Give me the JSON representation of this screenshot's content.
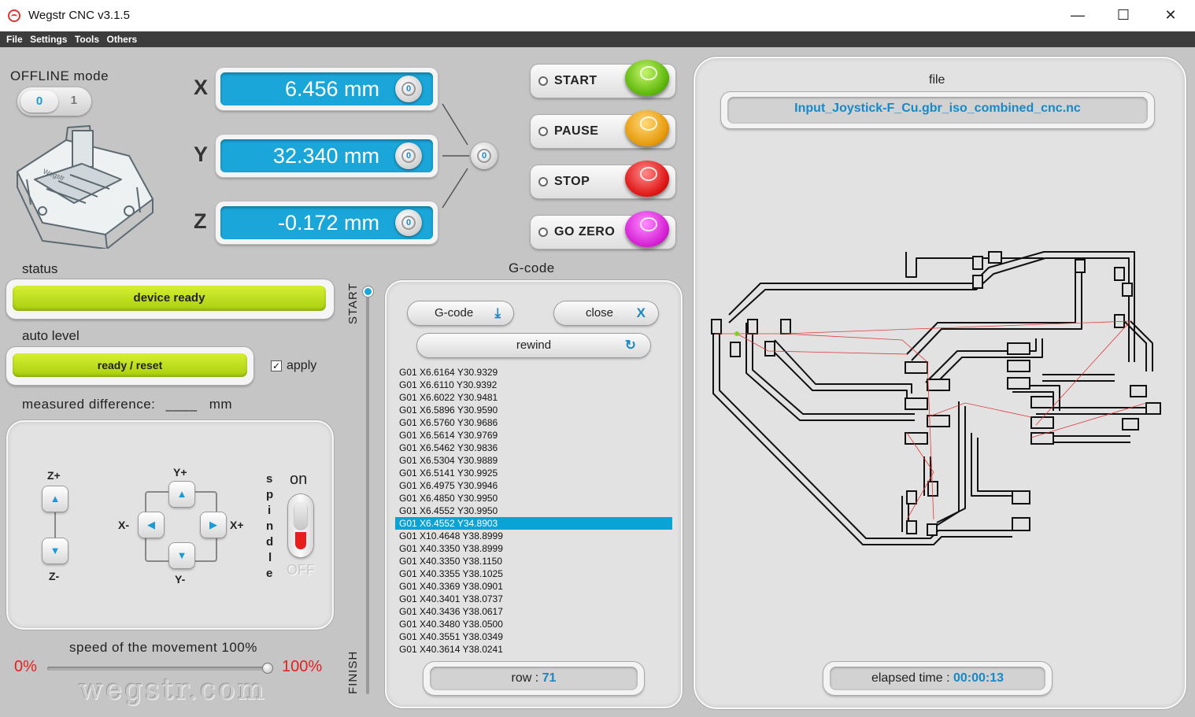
{
  "window": {
    "title": "Wegstr CNC  v3.1.5",
    "minimize": "—",
    "maximize": "☐",
    "close": "✕"
  },
  "menu": [
    "File",
    "Settings",
    "Tools",
    "Others"
  ],
  "offline": {
    "label": "OFFLINE mode",
    "on_value": "0",
    "off_value": "1"
  },
  "axes": [
    {
      "letter": "X",
      "value": "6.456 mm"
    },
    {
      "letter": "Y",
      "value": "32.340 mm"
    },
    {
      "letter": "Z",
      "value": "-0.172 mm"
    }
  ],
  "zero_glyph": "0",
  "controls": [
    {
      "label": "START",
      "color": "#7ed321"
    },
    {
      "label": "PAUSE",
      "color": "#f0a818"
    },
    {
      "label": "STOP",
      "color": "#e02020"
    },
    {
      "label": "GO ZERO",
      "color": "#d62ad6"
    }
  ],
  "status": {
    "label": "status",
    "value": "device ready"
  },
  "auto_level": {
    "label": "auto level",
    "button": "ready / reset",
    "apply_checked": true,
    "apply_label": "apply",
    "checkmark": "✓"
  },
  "measured": {
    "label": "measured difference:",
    "value": "____",
    "unit": "mm"
  },
  "jog": {
    "z_plus": "Z+",
    "z_minus": "Z-",
    "y_plus": "Y+",
    "y_minus": "Y-",
    "x_plus": "X+",
    "x_minus": "X-",
    "up_arrow": "▲",
    "down_arrow": "▼",
    "left_arrow": "◀",
    "right_arrow": "▶",
    "spindle_letters": [
      "s",
      "p",
      "i",
      "n",
      "d",
      "l",
      "e"
    ],
    "spindle_on": "on",
    "spindle_off": "OFF"
  },
  "speed": {
    "label": "speed of the movement 100%",
    "min": "0%",
    "max": "100%",
    "percent": 100
  },
  "watermark": "wegstr.com",
  "progress": {
    "start": "START",
    "finish": "FINISH"
  },
  "gcode": {
    "title": "G-code",
    "gcode_button": "G-code",
    "download_icon": "⤓",
    "close_button": "close",
    "close_icon": "X",
    "rewind_button": "rewind",
    "rewind_icon": "↻",
    "lines": [
      "G01 X6.6164 Y30.9329",
      "G01 X6.6110 Y30.9392",
      "G01 X6.6022 Y30.9481",
      "G01 X6.5896 Y30.9590",
      "G01 X6.5760 Y30.9686",
      "G01 X6.5614 Y30.9769",
      "G01 X6.5462 Y30.9836",
      "G01 X6.5304 Y30.9889",
      "G01 X6.5141 Y30.9925",
      "G01 X6.4975 Y30.9946",
      "G01 X6.4850 Y30.9950",
      "G01 X6.4552 Y30.9950",
      "G01 X6.4552 Y34.8903",
      "G01 X10.4648 Y38.8999",
      "G01 X40.3350 Y38.8999",
      "G01 X40.3350 Y38.1150",
      "G01 X40.3355 Y38.1025",
      "G01 X40.3369 Y38.0901",
      "G01 X40.3401 Y38.0737",
      "G01 X40.3436 Y38.0617",
      "G01 X40.3480 Y38.0500",
      "G01 X40.3551 Y38.0349",
      "G01 X40.3614 Y38.0241"
    ],
    "selected_index": 12,
    "row_label": "row :",
    "row_value": "71"
  },
  "preview": {
    "file_label": "file",
    "file_name": "Input_Joystick-F_Cu.gbr_iso_combined_cnc.nc",
    "elapsed_label": "elapsed time :",
    "elapsed_value": "00:00:13"
  }
}
